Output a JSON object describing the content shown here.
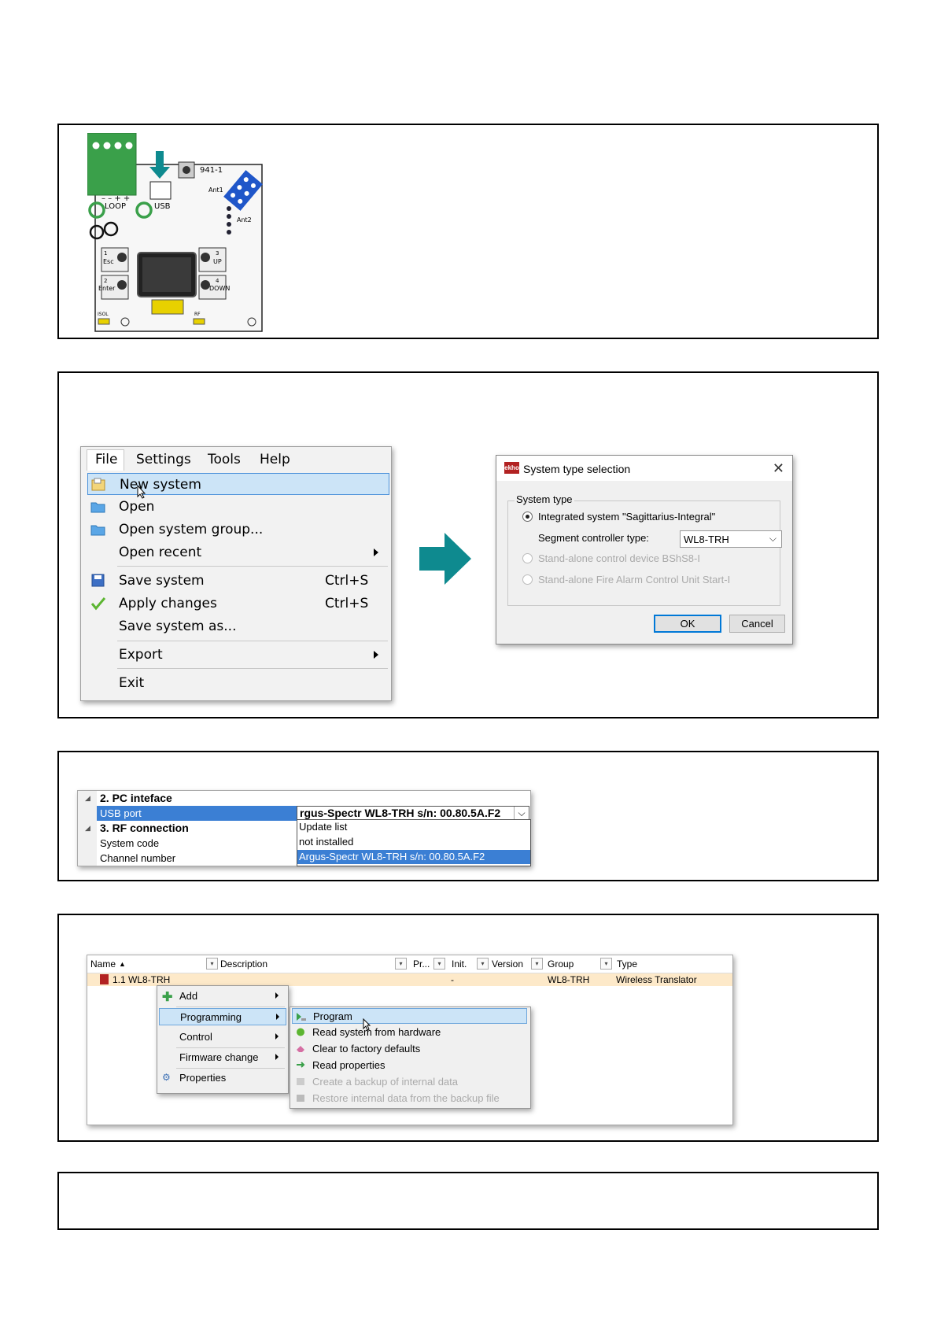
{
  "panel1": {
    "board": {
      "loop_label": "– – + +\nLOOP",
      "usb_label": "USB",
      "model_label": "941-1",
      "ant1_label": "Ant1",
      "ant2_label": "Ant2",
      "btn1_label": "1\nEsc",
      "btn2_label": "2\nEnter",
      "btn3_label": "3\nUP",
      "btn4_label": "4\nDOWN",
      "isol_label": "ISOL",
      "rf_label": "RF"
    }
  },
  "panel2": {
    "menu": {
      "bar": [
        "File",
        "Settings",
        "Tools",
        "Help"
      ],
      "items": [
        {
          "label": "New system",
          "shortcut": ""
        },
        {
          "label": "Open",
          "shortcut": ""
        },
        {
          "label": "Open system group...",
          "shortcut": ""
        },
        {
          "label": "Open recent",
          "shortcut": ""
        },
        {
          "label": "Save system",
          "shortcut": "Ctrl+S"
        },
        {
          "label": "Apply changes",
          "shortcut": "Ctrl+S"
        },
        {
          "label": "Save system as...",
          "shortcut": ""
        },
        {
          "label": "Export",
          "shortcut": ""
        },
        {
          "label": "Exit",
          "shortcut": ""
        }
      ]
    },
    "dialog": {
      "logo": "ekho",
      "title": "System type selection",
      "group_label": "System type",
      "option1": "Integrated system \"Sagittarius-Integral\"",
      "segment_label": "Segment controller type:",
      "segment_value": "WL8-TRH",
      "option2": "Stand-alone control device BShS8-I",
      "option3": "Stand-alone Fire Alarm Control Unit Start-I",
      "ok": "OK",
      "cancel": "Cancel"
    }
  },
  "panel3": {
    "cat2": "2. PC inteface",
    "usb_port_label": "USB port",
    "usb_port_value": "rgus-Spectr WL8-TRH s/n: 00.80.5A.F2",
    "cat3": "3. RF connection",
    "system_code_label": "System code",
    "channel_label": "Channel number",
    "dropdown": [
      "Update list",
      "not installed",
      "Argus-Spectr WL8-TRH s/n: 00.80.5A.F2"
    ]
  },
  "panel4": {
    "columns": [
      "Name",
      "Description",
      "Pr...",
      "Init.",
      "Version",
      "Group",
      "Type"
    ],
    "row": {
      "name": "1.1 WL8-TRH",
      "dash": "-",
      "group": "WL8-TRH",
      "type": "Wireless Translator"
    },
    "context": [
      "Add",
      "Programming",
      "Control",
      "Firmware change",
      "Properties"
    ],
    "submenu": [
      "Program",
      "Read system from hardware",
      "Clear to factory defaults",
      "Read properties",
      "Create a backup of internal data",
      "Restore internal data from the backup file"
    ]
  },
  "colors": {
    "accent_teal": "#0e8a8f",
    "highlight": "#cce4f7",
    "row_highlight": "#fde9c9",
    "pcb_green": "#3aa04a",
    "jumper_blue": "#1f56c9"
  }
}
